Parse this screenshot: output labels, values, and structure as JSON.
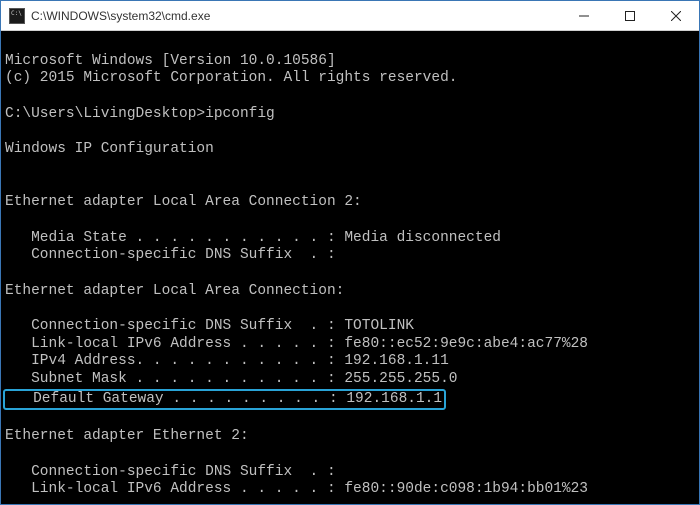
{
  "window": {
    "title": "C:\\WINDOWS\\system32\\cmd.exe"
  },
  "console": {
    "banner1": "Microsoft Windows [Version 10.0.10586]",
    "banner2": "(c) 2015 Microsoft Corporation. All rights reserved.",
    "prompt_line": "C:\\Users\\LivingDesktop>ipconfig",
    "heading": "Windows IP Configuration",
    "adapter1": {
      "title": "Ethernet adapter Local Area Connection 2:",
      "media_state": "   Media State . . . . . . . . . . . : Media disconnected",
      "dns_suffix": "   Connection-specific DNS Suffix  . :"
    },
    "adapter2": {
      "title": "Ethernet adapter Local Area Connection:",
      "dns_suffix": "   Connection-specific DNS Suffix  . : TOTOLINK",
      "ipv6": "   Link-local IPv6 Address . . . . . : fe80::ec52:9e9c:abe4:ac77%28",
      "ipv4": "   IPv4 Address. . . . . . . . . . . : 192.168.1.11",
      "subnet": "   Subnet Mask . . . . . . . . . . . : 255.255.255.0",
      "gateway": "   Default Gateway . . . . . . . . . : 192.168.1.1"
    },
    "adapter3": {
      "title": "Ethernet adapter Ethernet 2:",
      "dns_suffix": "   Connection-specific DNS Suffix  . :",
      "ipv6": "   Link-local IPv6 Address . . . . . : fe80::90de:c098:1b94:bb01%23"
    }
  }
}
